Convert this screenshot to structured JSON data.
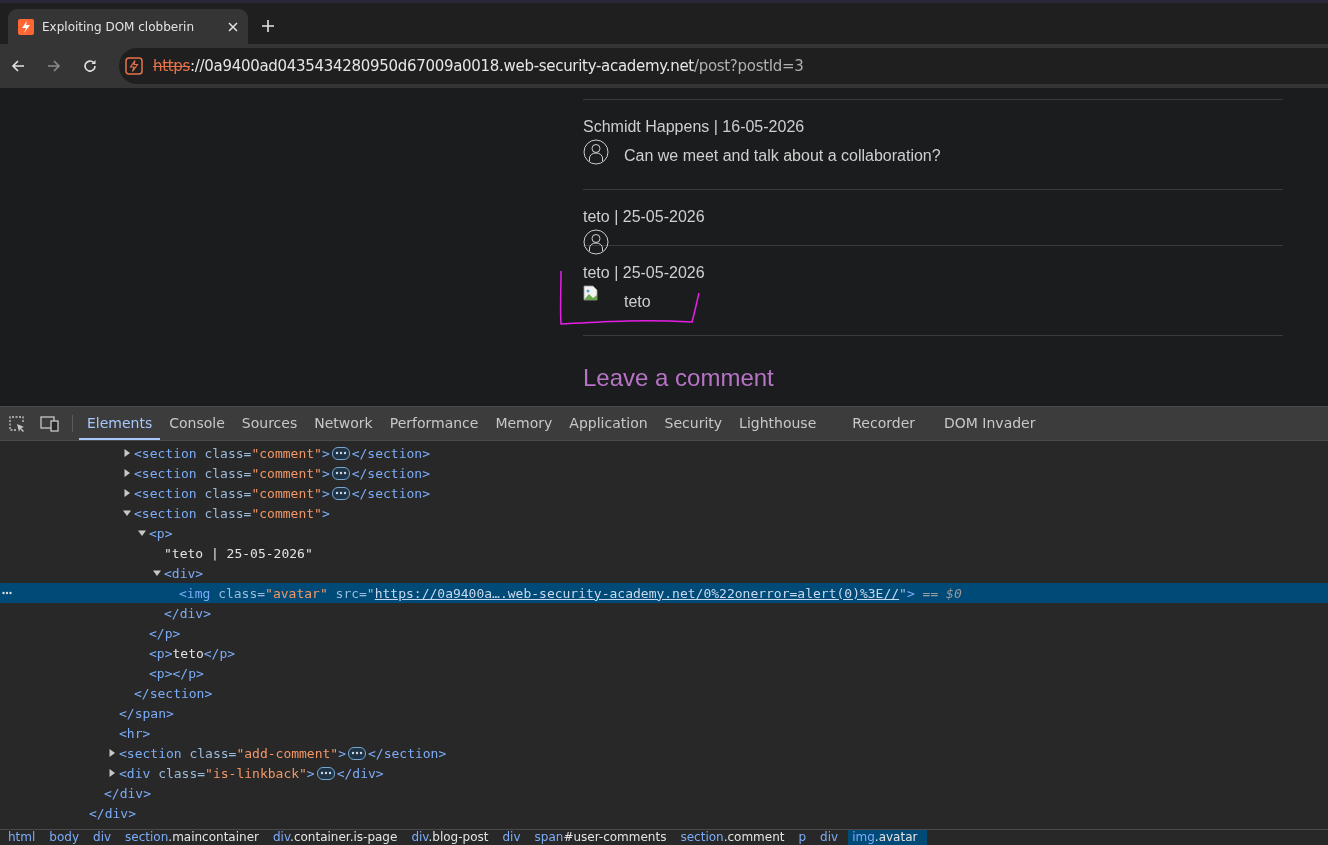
{
  "browser": {
    "tab": {
      "title": "Exploiting DOM clobberin"
    },
    "url": {
      "scheme": "https",
      "host": "://0a9400ad0435434280950d67009a0018.web-security-academy.net",
      "path": "/post?postId=3"
    }
  },
  "page": {
    "comments": [
      {
        "author_line": "Schmidt Happens | 16-05-2026",
        "kind": "default",
        "text": "Can we meet and talk about a collaboration?"
      },
      {
        "author_line": "teto | 25-05-2026",
        "kind": "default"
      },
      {
        "author_line": "teto | 25-05-2026",
        "kind": "broken",
        "text": "teto"
      }
    ],
    "heading": "Leave a comment"
  },
  "devtools": {
    "tabs": [
      {
        "label": "Elements",
        "selected": true
      },
      {
        "label": "Console",
        "selected": false
      },
      {
        "label": "Sources",
        "selected": false
      },
      {
        "label": "Network",
        "selected": false
      },
      {
        "label": "Performance",
        "selected": false
      },
      {
        "label": "Memory",
        "selected": false
      },
      {
        "label": "Application",
        "selected": false
      },
      {
        "label": "Security",
        "selected": false
      },
      {
        "label": "Lighthouse",
        "selected": false
      },
      {
        "label": "Recorder",
        "selected": false
      },
      {
        "label": "DOM Invader",
        "selected": false
      }
    ],
    "tree": [
      {
        "close": [
          {
            "kind": "tag",
            "text": "</div>"
          }
        ],
        "children": [
          {
            "close": [
              {
                "kind": "tag",
                "text": "</div>"
              }
            ],
            "children": [
              {
                "close": [
                  {
                    "kind": "tag",
                    "text": "</span>"
                  }
                ],
                "children": [
                  {
                    "selected": false,
                    "expanded": false,
                    "open": [
                      {
                        "kind": "tag",
                        "text": "<section"
                      },
                      {
                        "kind": "attr",
                        "text": " class="
                      },
                      {
                        "kind": "value",
                        "text": "\"comment\""
                      },
                      {
                        "kind": "tag",
                        "text": ">"
                      }
                    ],
                    "close": [
                      {
                        "kind": "tag",
                        "text": "</section>"
                      }
                    ]
                  },
                  {
                    "selected": false,
                    "expanded": false,
                    "open": [
                      {
                        "kind": "tag",
                        "text": "<section"
                      },
                      {
                        "kind": "attr",
                        "text": " class="
                      },
                      {
                        "kind": "value",
                        "text": "\"comment\""
                      },
                      {
                        "kind": "tag",
                        "text": ">"
                      }
                    ],
                    "close": [
                      {
                        "kind": "tag",
                        "text": "</section>"
                      }
                    ]
                  },
                  {
                    "selected": false,
                    "expanded": false,
                    "open": [
                      {
                        "kind": "tag",
                        "text": "<section"
                      },
                      {
                        "kind": "attr",
                        "text": " class="
                      },
                      {
                        "kind": "value",
                        "text": "\"comment\""
                      },
                      {
                        "kind": "tag",
                        "text": ">"
                      }
                    ],
                    "close": [
                      {
                        "kind": "tag",
                        "text": "</section>"
                      }
                    ]
                  },
                  {
                    "selected": false,
                    "expanded": true,
                    "open": [
                      {
                        "kind": "tag",
                        "text": "<section"
                      },
                      {
                        "kind": "attr",
                        "text": " class="
                      },
                      {
                        "kind": "value",
                        "text": "\"comment\""
                      },
                      {
                        "kind": "tag",
                        "text": ">"
                      }
                    ],
                    "close": [
                      {
                        "kind": "tag",
                        "text": "</section>"
                      }
                    ],
                    "children": [
                      {
                        "selected": false,
                        "expanded": true,
                        "open": [
                          {
                            "kind": "tag",
                            "text": "<p>"
                          }
                        ],
                        "close": [
                          {
                            "kind": "tag",
                            "text": "</p>"
                          }
                        ],
                        "children": [
                          {
                            "selected": false,
                            "open": [
                              {
                                "kind": "text",
                                "text": "\"teto | 25-05-2026\""
                              }
                            ]
                          },
                          {
                            "selected": false,
                            "expanded": true,
                            "open": [
                              {
                                "kind": "tag",
                                "text": "<div>"
                              }
                            ],
                            "close": [
                              {
                                "kind": "tag",
                                "text": "</div>"
                              }
                            ],
                            "children": [
                              {
                                "selected": true,
                                "open": [
                                  {
                                    "kind": "tag",
                                    "text": "<img"
                                  },
                                  {
                                    "kind": "attr",
                                    "text": " class="
                                  },
                                  {
                                    "kind": "value",
                                    "text": "\"avatar\""
                                  },
                                  {
                                    "kind": "attr",
                                    "text": " src=\""
                                  },
                                  {
                                    "kind": "link",
                                    "text": "https://0a9400a….web-security-academy.net/0%22onerror=alert(0)%3E//"
                                  },
                                  {
                                    "kind": "attr",
                                    "text": "\""
                                  },
                                  {
                                    "kind": "tag",
                                    "text": ">"
                                  },
                                  {
                                    "kind": "ref",
                                    "text": " == $0"
                                  }
                                ]
                              }
                            ]
                          }
                        ]
                      },
                      {
                        "selected": false,
                        "open": [
                          {
                            "kind": "tag",
                            "text": "<p>"
                          },
                          {
                            "kind": "text",
                            "text": "teto"
                          },
                          {
                            "kind": "tag",
                            "text": "</p>"
                          }
                        ]
                      },
                      {
                        "selected": false,
                        "open": [
                          {
                            "kind": "tag",
                            "text": "<p></p>"
                          }
                        ]
                      }
                    ]
                  }
                ]
              },
              {
                "selected": false,
                "open": [
                  {
                    "kind": "tag",
                    "text": "<hr>"
                  }
                ]
              },
              {
                "selected": false,
                "expanded": false,
                "open": [
                  {
                    "kind": "tag",
                    "text": "<section"
                  },
                  {
                    "kind": "attr",
                    "text": " class="
                  },
                  {
                    "kind": "value",
                    "text": "\"add-comment\""
                  },
                  {
                    "kind": "tag",
                    "text": ">"
                  }
                ],
                "close": [
                  {
                    "kind": "tag",
                    "text": "</section>"
                  }
                ]
              },
              {
                "selected": false,
                "expanded": false,
                "open": [
                  {
                    "kind": "tag",
                    "text": "<div"
                  },
                  {
                    "kind": "attr",
                    "text": " class="
                  },
                  {
                    "kind": "value",
                    "text": "\"is-linkback\""
                  },
                  {
                    "kind": "tag",
                    "text": ">"
                  }
                ],
                "close": [
                  {
                    "kind": "tag",
                    "text": "</div>"
                  }
                ]
              }
            ]
          }
        ]
      }
    ],
    "breadcrumbs": [
      {
        "tag": "html",
        "selected": false
      },
      {
        "tag": "body",
        "selected": false
      },
      {
        "tag": "div",
        "selected": false
      },
      {
        "tag": "section",
        "suffix": ".maincontainer",
        "selected": false
      },
      {
        "tag": "div",
        "suffix": ".container.is-page",
        "selected": false
      },
      {
        "tag": "div",
        "suffix": ".blog-post",
        "selected": false
      },
      {
        "tag": "div",
        "selected": false
      },
      {
        "tag": "span",
        "suffix": "#user-comments",
        "selected": false
      },
      {
        "tag": "section",
        "suffix": ".comment",
        "selected": false
      },
      {
        "tag": "p",
        "selected": false
      },
      {
        "tag": "div",
        "selected": false
      },
      {
        "tag": "img",
        "suffix": ".avatar",
        "selected": true
      }
    ]
  }
}
